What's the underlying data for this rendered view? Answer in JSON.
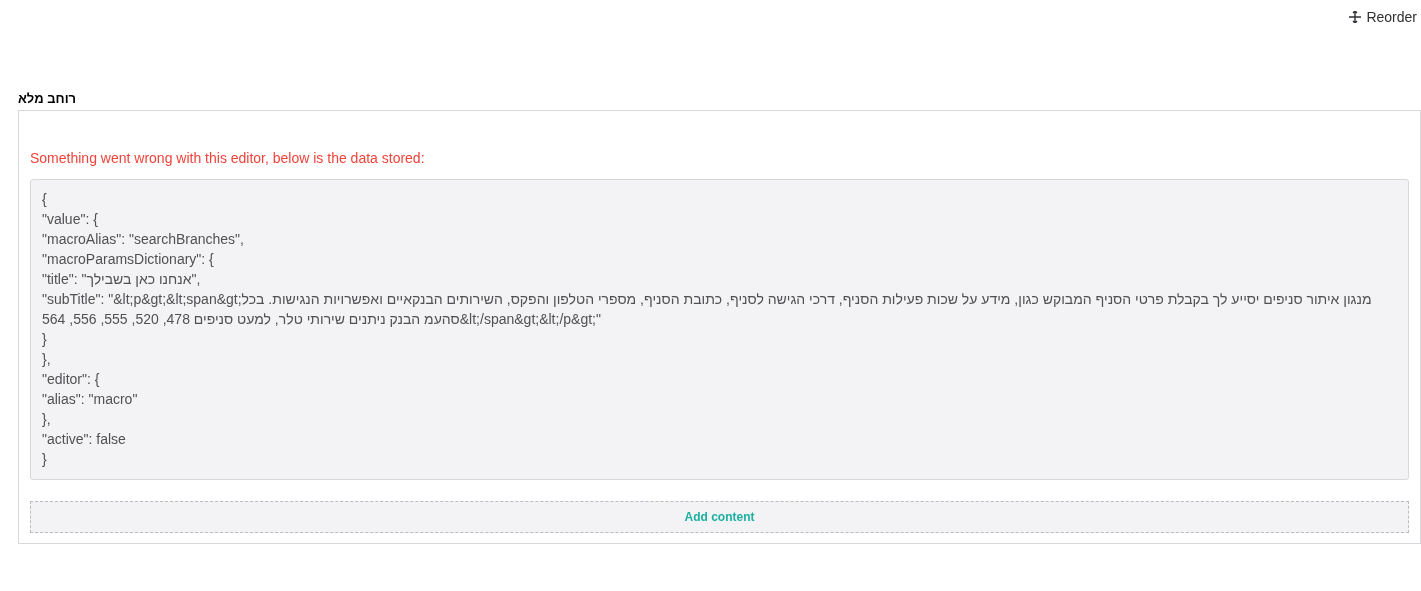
{
  "toolbar": {
    "reorder_label": "Reorder"
  },
  "section": {
    "title": "רוחב מלא",
    "error_message": "Something went wrong with this editor, below is the data stored:",
    "stored_data_lines": [
      "{",
      "\"value\": {",
      "\"macroAlias\": \"searchBranches\",",
      "\"macroParamsDictionary\": {",
      "\"title\": \"אנחנו כאן בשבילך\",",
      "\"subTitle\": \"&lt;p&gt;&lt;span&gt;מנגון איתור סניפים יסייע לך בקבלת פרטי הסניף המבוקש כגון, מידע על שכות פעילות הסניף, דרכי הגישה לסניף, כתובת הסניף, מספרי הטלפון והפקס, השירותים הבנקאיים ואפשרויות הנגישות. בכל סהעמ הבנק ניתנים שירותי טלר, למעט סניפים 478, 520, 555, 556, 564&lt;/span&gt;&lt;/p&gt;\"",
      "}",
      "},",
      "\"editor\": {",
      "\"alias\": \"macro\"",
      "},",
      "\"active\": false",
      "}"
    ],
    "add_button": "Add content"
  }
}
